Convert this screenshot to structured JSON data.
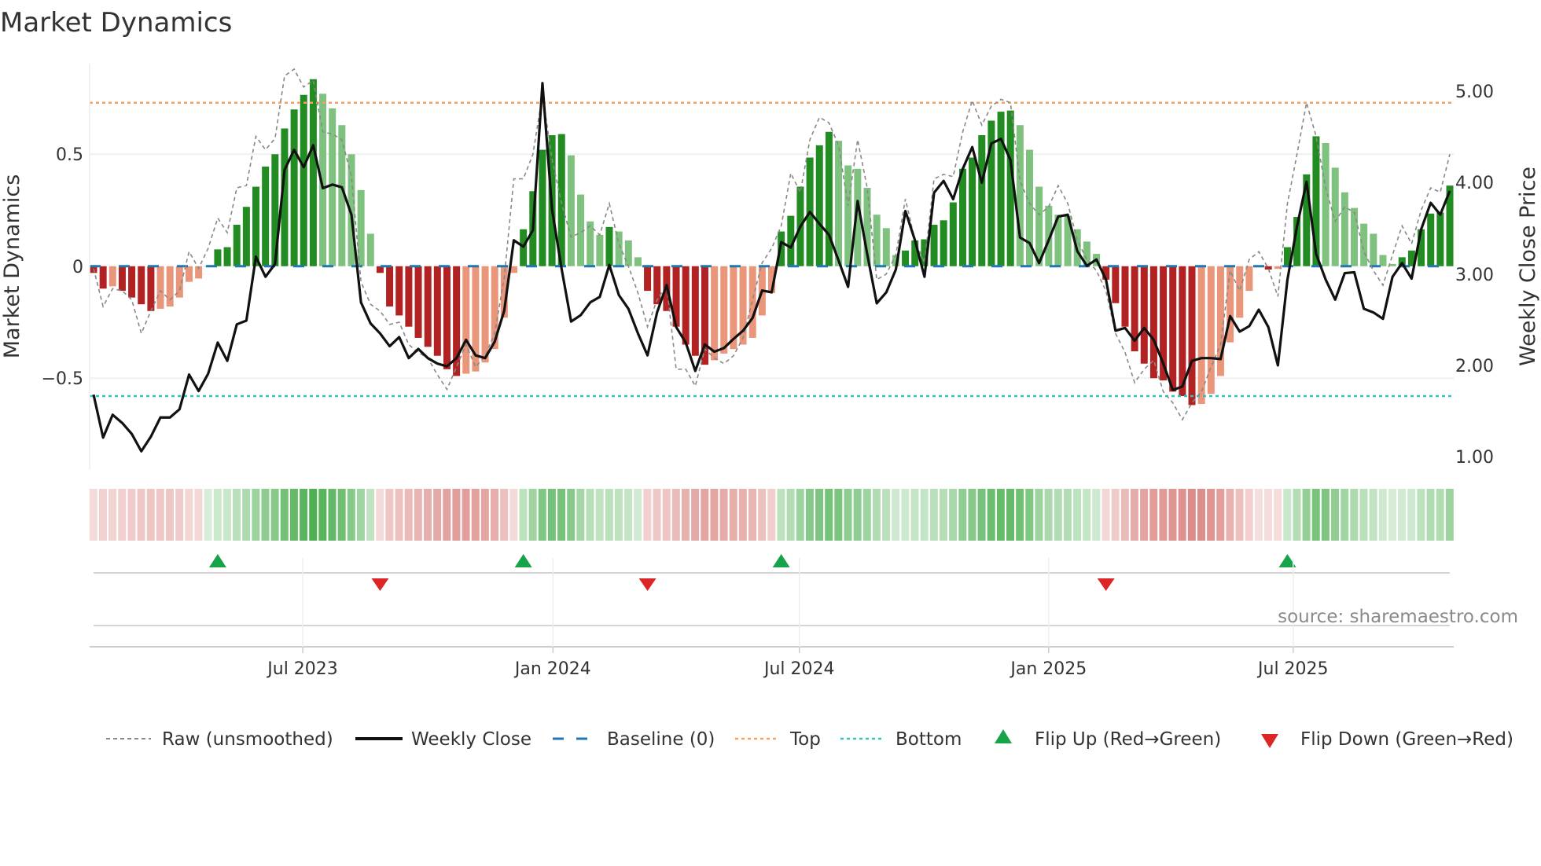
{
  "chart_data": {
    "type": "bar",
    "title": "Market Dynamics",
    "ylabel": "Market Dynamics",
    "y2label": "Weekly Close Price",
    "ylim": [
      -0.91,
      0.9
    ],
    "y2lim": [
      0.86,
      5.3
    ],
    "y_ticks": [
      {
        "value": 0.5,
        "label": "0.5"
      },
      {
        "value": 0,
        "label": "0"
      },
      {
        "value": -0.5,
        "label": "−0.5"
      }
    ],
    "y2_ticks": [
      {
        "value": 5,
        "label": "5.00"
      },
      {
        "value": 4,
        "label": "4.00"
      },
      {
        "value": 3,
        "label": "3.00"
      },
      {
        "value": 2,
        "label": "2.00"
      },
      {
        "value": 1,
        "label": "1.00"
      }
    ],
    "x_unit": "week index",
    "x_ticks": [
      {
        "week": 21.9,
        "label": "Jul 2023"
      },
      {
        "week": 48.1,
        "label": "Jan 2024"
      },
      {
        "week": 73.9,
        "label": "Jul 2024"
      },
      {
        "week": 100.0,
        "label": "Jan 2025"
      },
      {
        "week": 125.6,
        "label": "Jul 2025"
      }
    ],
    "top_level": 0.73,
    "bottom_level": -0.58,
    "baseline": 0,
    "dynamics": [
      -0.03,
      -0.1,
      -0.09,
      -0.11,
      -0.14,
      -0.17,
      -0.2,
      -0.19,
      -0.18,
      -0.14,
      -0.07,
      -0.055,
      0,
      0.075,
      0.085,
      0.185,
      0.265,
      0.355,
      0.445,
      0.5,
      0.615,
      0.7,
      0.765,
      0.835,
      0.77,
      0.705,
      0.63,
      0.5,
      0.34,
      0.145,
      -0.03,
      -0.18,
      -0.22,
      -0.27,
      -0.32,
      -0.36,
      -0.4,
      -0.46,
      -0.49,
      -0.48,
      -0.47,
      -0.43,
      -0.37,
      -0.23,
      -0.03,
      0.165,
      0.335,
      0.52,
      0.585,
      0.59,
      0.495,
      0.32,
      0.2,
      0.14,
      0.175,
      0.155,
      0.115,
      0.04,
      -0.11,
      -0.17,
      -0.2,
      -0.27,
      -0.35,
      -0.4,
      -0.44,
      -0.42,
      -0.39,
      -0.37,
      -0.35,
      -0.32,
      -0.22,
      -0.12,
      0.155,
      0.225,
      0.355,
      0.485,
      0.54,
      0.6,
      0.56,
      0.45,
      0.435,
      0.35,
      0.23,
      0.17,
      0.05,
      0.07,
      0.115,
      0.12,
      0.185,
      0.205,
      0.285,
      0.435,
      0.485,
      0.585,
      0.65,
      0.69,
      0.695,
      0.63,
      0.52,
      0.355,
      0.27,
      0.23,
      0.225,
      0.165,
      0.11,
      0.055,
      -0.06,
      -0.165,
      -0.27,
      -0.38,
      -0.435,
      -0.5,
      -0.51,
      -0.56,
      -0.58,
      -0.62,
      -0.615,
      -0.57,
      -0.49,
      -0.34,
      -0.23,
      -0.11,
      -0.005,
      -0.015,
      -0.012,
      0.085,
      0.22,
      0.41,
      0.58,
      0.55,
      0.44,
      0.33,
      0.26,
      0.19,
      0.145,
      0.05,
      0.01,
      0.04,
      0.07,
      0.165,
      0.235,
      0.24,
      0.36
    ],
    "raw": [
      -0.01,
      -0.18,
      -0.1,
      -0.11,
      -0.15,
      -0.3,
      -0.2,
      -0.11,
      -0.15,
      -0.11,
      0.065,
      -0.01,
      0.08,
      0.215,
      0.15,
      0.35,
      0.36,
      0.58,
      0.52,
      0.57,
      0.85,
      0.88,
      0.8,
      0.83,
      0.6,
      0.59,
      0.565,
      0.4,
      -0.07,
      -0.17,
      -0.2,
      -0.26,
      -0.25,
      -0.35,
      -0.385,
      -0.41,
      -0.485,
      -0.55,
      -0.45,
      -0.35,
      -0.45,
      -0.4,
      -0.3,
      -0.05,
      0.39,
      0.39,
      0.5,
      0.765,
      0.48,
      0.28,
      0.13,
      0.15,
      0.18,
      0.14,
      0.28,
      0.1,
      0,
      -0.12,
      -0.27,
      -0.15,
      -0.085,
      -0.46,
      -0.46,
      -0.535,
      -0.37,
      -0.41,
      -0.435,
      -0.4,
      -0.32,
      -0.15,
      0.015,
      0.08,
      0.18,
      0.415,
      0.33,
      0.565,
      0.665,
      0.64,
      0.54,
      0.27,
      0.565,
      0.35,
      -0.06,
      -0.035,
      0.05,
      0.3,
      0.115,
      0.015,
      0.39,
      0.41,
      0.4,
      0.6,
      0.74,
      0.63,
      0.715,
      0.745,
      0.73,
      0.38,
      0.28,
      0.23,
      0.265,
      0.36,
      0.28,
      0.115,
      0.03,
      -0.02,
      -0.11,
      -0.3,
      -0.385,
      -0.52,
      -0.46,
      -0.42,
      -0.56,
      -0.61,
      -0.685,
      -0.61,
      -0.56,
      -0.45,
      -0.35,
      -0.02,
      -0.11,
      0.03,
      0.065,
      -0.01,
      -0.135,
      0.28,
      0.5,
      0.73,
      0.58,
      0.35,
      0.2,
      0.265,
      0.24,
      0.065,
      -0.02,
      -0.085,
      0.05,
      0.18,
      0.1,
      0.25,
      0.35,
      0.33,
      0.5
    ],
    "weekly_close": [
      1.68,
      1.21,
      1.46,
      1.37,
      1.25,
      1.06,
      1.22,
      1.43,
      1.43,
      1.52,
      1.9,
      1.72,
      1.91,
      2.25,
      2.05,
      2.45,
      2.49,
      3.19,
      2.97,
      3.11,
      4.14,
      4.36,
      4.17,
      4.41,
      3.94,
      3.98,
      3.95,
      3.65,
      2.69,
      2.46,
      2.35,
      2.21,
      2.31,
      2.08,
      2.18,
      2.08,
      2.02,
      1.99,
      2.08,
      2.28,
      2.11,
      2.08,
      2.26,
      2.6,
      3.37,
      3.3,
      3.48,
      5.09,
      3.71,
      3.06,
      2.48,
      2.55,
      2.69,
      2.75,
      3.1,
      2.77,
      2.62,
      2.35,
      2.11,
      2.58,
      2.88,
      2.42,
      2.25,
      1.94,
      2.23,
      2.15,
      2.19,
      2.29,
      2.38,
      2.52,
      2.82,
      2.8,
      3.35,
      3.29,
      3.52,
      3.68,
      3.55,
      3.43,
      3.15,
      2.86,
      3.8,
      3.22,
      2.68,
      2.8,
      3.05,
      3.69,
      3.37,
      2.97,
      3.89,
      4.02,
      3.82,
      4.15,
      4.39,
      4.0,
      4.43,
      4.48,
      4.25,
      3.4,
      3.34,
      3.12,
      3.37,
      3.63,
      3.65,
      3.25,
      3.09,
      3.16,
      2.94,
      2.38,
      2.41,
      2.27,
      2.41,
      2.28,
      2.02,
      1.73,
      1.77,
      2.05,
      2.08,
      2.08,
      2.07,
      2.54,
      2.37,
      2.43,
      2.61,
      2.42,
      2.0,
      2.94,
      3.52,
      4.01,
      3.22,
      2.94,
      2.72,
      3.01,
      3.02,
      2.62,
      2.58,
      2.51,
      2.97,
      3.12,
      2.95,
      3.49,
      3.78,
      3.65,
      3.91
    ],
    "flip_up_weeks": [
      13,
      45,
      72,
      125
    ],
    "flip_down_weeks": [
      30,
      58,
      106
    ],
    "legend": {
      "placement": "bottom",
      "raw": "Raw (unsmoothed)",
      "close": "Weekly Close",
      "baseline": "Baseline (0)",
      "top": "Top",
      "bottom": "Bottom",
      "flip_up": "Flip Up (Red→Green)",
      "flip_down": "Flip Down (Green→Red)"
    },
    "annotation": "source: sharemaestro.com",
    "colors": {
      "green_strong": "#228b22",
      "green_fading": "#7fc27f",
      "red_strong": "#b22222",
      "red_fading": "#e9967a",
      "raw": "#888888",
      "close": "#111111",
      "baseline": "#1f77b4",
      "top": "#f4a261",
      "bottom": "#2ec4c4",
      "flip_up": "#16a34a",
      "flip_down": "#dc2626",
      "strip_green": "76,175,80",
      "strip_red": "210,110,105"
    }
  }
}
